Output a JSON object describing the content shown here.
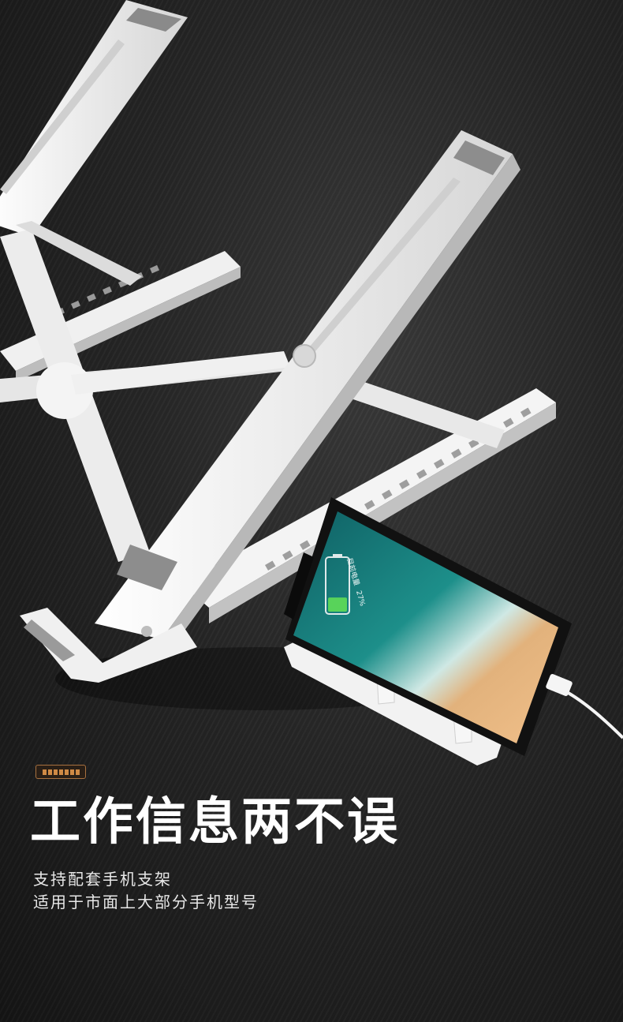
{
  "headline": "工作信息两不误",
  "subtitle_lines": [
    "支持配套手机支架",
    "适用于市面上大部分手机型号"
  ],
  "phone_screen": {
    "battery_label": "目前电量",
    "battery_percent": "27%",
    "battery_level": 0.27
  },
  "colors": {
    "stand": "#f2f2f2",
    "stand_shadow": "#c9c9c9",
    "pad": "#8a8a8a",
    "tag_border": "#a8713f",
    "tag_fill": "#d08a45",
    "background": "#262626"
  }
}
